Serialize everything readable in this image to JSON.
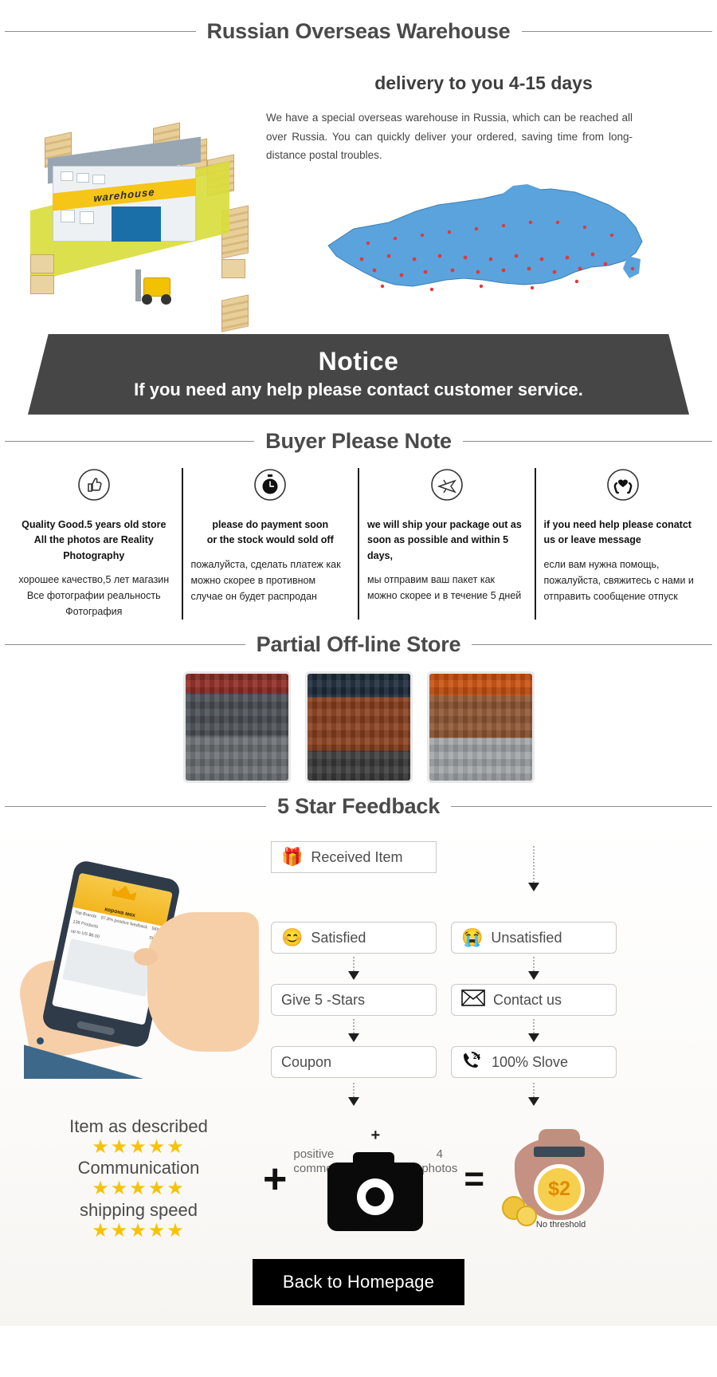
{
  "header": {
    "title": "Russian Overseas Warehouse"
  },
  "hero": {
    "subtitle": "delivery to you 4-15 days",
    "body": "We have a special overseas warehouse in Russia, which can be reached all over Russia. You can quickly deliver your ordered, saving time from long-distance postal troubles.",
    "warehouse_label": "warehouse"
  },
  "notice": {
    "title": "Notice",
    "text": "If you need any help please contact customer service."
  },
  "buyer_note": {
    "heading": "Buyer Please Note",
    "columns": [
      {
        "icon": "thumbs-up-icon",
        "en": "Quality Good.5 years old store\nAll the photos are Reality Photography",
        "ru": "хорошее качество,5 лет магазин\nВсе фотографии реальность Фотография"
      },
      {
        "icon": "stopwatch-icon",
        "en": "please do payment soon\nor the stock would sold off",
        "ru": "пожалуйста, сделать платеж как можно скорее в противном случае он будет распродан"
      },
      {
        "icon": "airplane-icon",
        "en": "we will ship your package out as soon as possible and within 5 days,",
        "ru": "мы отправим ваш пакет как можно скорее и в течение 5 дней"
      },
      {
        "icon": "caring-hands-icon",
        "en": "if you need help please conatct us or leave message",
        "ru": "если вам нужна помощь, пожалуйста, свяжитесь с нами и отправить сообщение отпуск"
      }
    ]
  },
  "offline_store": {
    "heading": "Partial Off-line Store",
    "photos": [
      "store-photo-1",
      "store-photo-2",
      "store-photo-3"
    ]
  },
  "feedback": {
    "heading": "5 Star Feedback",
    "flow": {
      "received": {
        "label": "Received Item",
        "icon": "gift-icon"
      },
      "satisfied": {
        "label": "Satisfied",
        "icon": "happy-face-icon"
      },
      "unsatisfied": {
        "label": "Unsatisfied",
        "icon": "crying-face-icon"
      },
      "give_stars": {
        "label": "Give 5 -Stars",
        "icon": ""
      },
      "contact": {
        "label": "Contact us",
        "icon": "envelope-icon"
      },
      "coupon": {
        "label": "Coupon",
        "icon": ""
      },
      "solve": {
        "label": "100% Slove",
        "icon": "support-24h-icon"
      }
    }
  },
  "ratings": {
    "rows": [
      {
        "label": "Item as described",
        "stars": 5
      },
      {
        "label": "Communication",
        "stars": 5
      },
      {
        "label": "shipping speed",
        "stars": 5
      }
    ],
    "plus": "+",
    "equals": "=",
    "camera": {
      "top_plus": "+",
      "left_label": "positive\ncomment",
      "right_label": "4\nphotos",
      "icon": "camera-icon"
    },
    "reward": {
      "amount": "$2",
      "note": "No threshold",
      "icon": "money-bag-icon"
    }
  },
  "footer": {
    "home_button": "Back to Homepage"
  },
  "colors": {
    "accent_yellow": "#f7c20a",
    "notice_bg": "#464646",
    "text_dark": "#3a3a3a",
    "map_blue": "#4f9bd9",
    "pin_red": "#e03a3a"
  }
}
